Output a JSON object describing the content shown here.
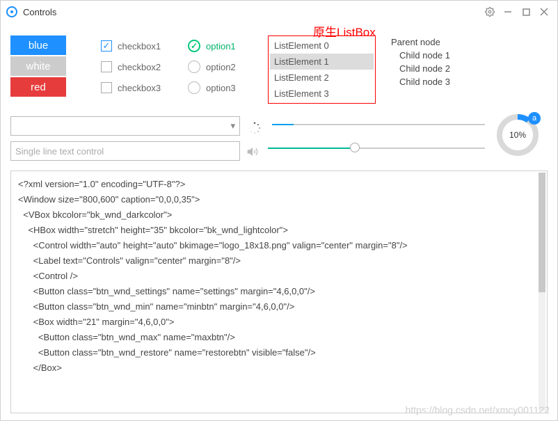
{
  "window": {
    "title": "Controls"
  },
  "annotation": "原生ListBox",
  "buttons": {
    "b1": "blue",
    "b2": "white",
    "b3": "red"
  },
  "checks": [
    {
      "label": "checkbox1",
      "checked": true
    },
    {
      "label": "checkbox2",
      "checked": false
    },
    {
      "label": "checkbox3",
      "checked": false
    }
  ],
  "radios": [
    {
      "label": "option1",
      "selected": true
    },
    {
      "label": "option2",
      "selected": false
    },
    {
      "label": "option3",
      "selected": false
    }
  ],
  "list": {
    "items": [
      "ListElement 0",
      "ListElement 1",
      "ListElement 2",
      "ListElement 3"
    ],
    "selected_index": 1
  },
  "tree": {
    "parent": "Parent node",
    "children": [
      "Child node 1",
      "Child node 2",
      "Child node 3"
    ]
  },
  "combo": {
    "value": ""
  },
  "textline": {
    "placeholder": "Single line text control"
  },
  "slider1": {
    "value": 10,
    "max": 100
  },
  "slider2": {
    "value": 40,
    "max": 100
  },
  "progress": {
    "label": "10%",
    "badge": "a"
  },
  "code_lines": [
    "<?xml version=\"1.0\" encoding=\"UTF-8\"?>",
    "<Window size=\"800,600\" caption=\"0,0,0,35\">",
    "  <VBox bkcolor=\"bk_wnd_darkcolor\">",
    "    <HBox width=\"stretch\" height=\"35\" bkcolor=\"bk_wnd_lightcolor\">",
    "      <Control width=\"auto\" height=\"auto\" bkimage=\"logo_18x18.png\" valign=\"center\" margin=\"8\"/>",
    "      <Label text=\"Controls\" valign=\"center\" margin=\"8\"/>",
    "      <Control />",
    "      <Button class=\"btn_wnd_settings\" name=\"settings\" margin=\"4,6,0,0\"/>",
    "      <Button class=\"btn_wnd_min\" name=\"minbtn\" margin=\"4,6,0,0\"/>",
    "      <Box width=\"21\" margin=\"4,6,0,0\">",
    "        <Button class=\"btn_wnd_max\" name=\"maxbtn\"/>",
    "        <Button class=\"btn_wnd_restore\" name=\"restorebtn\" visible=\"false\"/>",
    "      </Box>"
  ],
  "watermark": "https://blog.csdn.net/xmcy001122"
}
